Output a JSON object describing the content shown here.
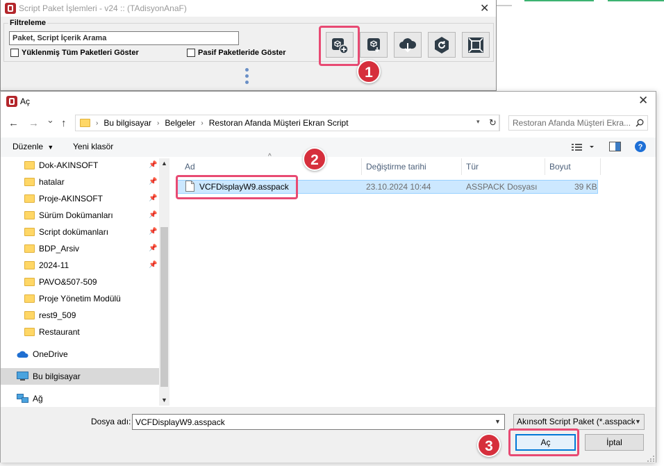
{
  "background_window": {
    "title": "Script Paket İşlemleri - v24 :: (TAdisyonAnaF)",
    "close_glyph": "✕",
    "filter_legend": "Filtreleme",
    "search_value": "Paket, Script İçerik Arama",
    "checkbox_all_installed": "Yüklenmiş Tüm Paketleri Göster",
    "checkbox_passive": "Pasif Paketleride Göster",
    "toolbar_icons": [
      "package-add-icon",
      "package-install-icon",
      "cloud-download-icon",
      "refresh-circle-icon",
      "fullscreen-icon"
    ]
  },
  "dialog": {
    "title": "Aç",
    "close_glyph": "✕",
    "nav": {
      "back": "←",
      "forward": "→",
      "recent": "⌄",
      "up": "↑"
    },
    "breadcrumbs": [
      "Bu bilgisayar",
      "Belgeler",
      "Restoran Afanda Müşteri Ekran Script"
    ],
    "refresh_glyph": "↻",
    "search_placeholder": "Restoran Afanda Müşteri Ekra...",
    "command_bar": {
      "organize": "Düzenle",
      "new_folder": "Yeni klasör"
    },
    "nav_pane": {
      "pinned_folders": [
        "Dok-AKINSOFT",
        "hatalar",
        "Proje-AKINSOFT",
        "Sürüm Dokümanları",
        "Script dokümanları",
        "BDP_Arsiv",
        "2024-11"
      ],
      "folders": [
        "PAVO&507-509",
        "Proje Yönetim Modülü",
        "rest9_509",
        "Restaurant"
      ],
      "onedrive": "OneDrive",
      "this_pc": "Bu bilgisayar",
      "network": "Ağ"
    },
    "columns": {
      "name": "Ad",
      "modified": "Değiştirme tarihi",
      "type": "Tür",
      "size": "Boyut"
    },
    "files": [
      {
        "name": "VCFDisplayW9.asspack",
        "modified": "23.10.2024 10:44",
        "type": "ASSPACK Dosyası",
        "size": "39 KB"
      }
    ],
    "filename_label": "Dosya adı:",
    "filename_value": "VCFDisplayW9.asspack",
    "filetype_value": "Akınsoft Script Paket (*.asspack",
    "open_button": "Aç",
    "cancel_button": "İptal"
  },
  "annotations": {
    "step1": "1",
    "step2": "2",
    "step3": "3",
    "highlight_color": "#e84a73",
    "badge_color": "#d62f3c"
  },
  "colors": {
    "selection": "#cce8ff",
    "accent": "#0078d7",
    "folder": "#ffd766"
  }
}
